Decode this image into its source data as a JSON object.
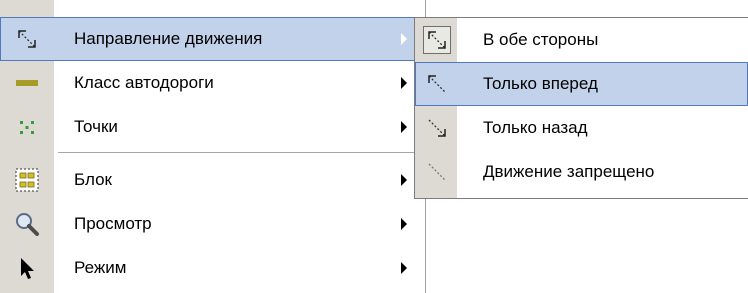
{
  "main_menu": {
    "items": [
      {
        "label": "Направление движения",
        "icon": "direction-arrow-icon"
      },
      {
        "label": "Класс автодороги",
        "icon": "road-class-bar-icon"
      },
      {
        "label": "Точки",
        "icon": "points-icon"
      },
      {
        "label": "Блок",
        "icon": "block-icon"
      },
      {
        "label": "Просмотр",
        "icon": "magnifier-icon"
      },
      {
        "label": "Режим",
        "icon": "cursor-arrow-icon"
      }
    ]
  },
  "sub_menu": {
    "items": [
      {
        "label": "В обе стороны",
        "icon": "both-directions-icon"
      },
      {
        "label": "Только вперед",
        "icon": "forward-only-icon"
      },
      {
        "label": "Только назад",
        "icon": "backward-only-icon"
      },
      {
        "label": "Движение запрещено",
        "icon": "traffic-prohibited-icon"
      }
    ]
  },
  "colors": {
    "highlight_fill": "#c2d2ea",
    "highlight_border": "#5278bd",
    "gutter": "#dcdad2",
    "road_class_bar": "#a79b2a",
    "points": "#3a9b3a",
    "block": "#d1bd2d"
  }
}
